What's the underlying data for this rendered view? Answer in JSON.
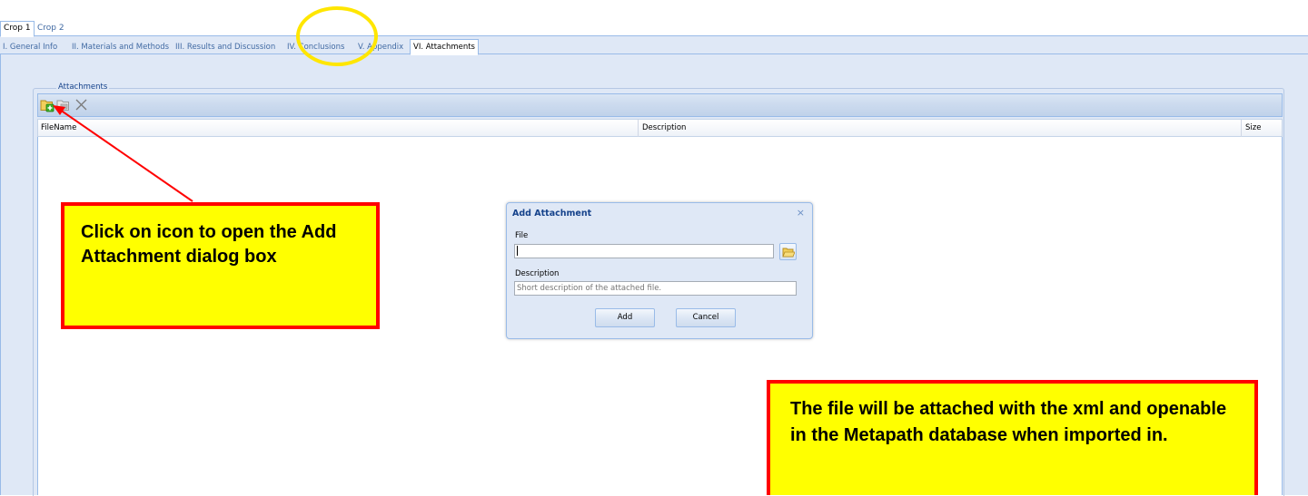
{
  "crop_tabs": [
    {
      "label": "Crop 1",
      "active": true
    },
    {
      "label": "Crop 2",
      "active": false
    }
  ],
  "section_tabs": [
    {
      "label": "I. General Info"
    },
    {
      "label": "II. Materials and Methods"
    },
    {
      "label": "III. Results and Discussion"
    },
    {
      "label": "IV. Conclusions"
    },
    {
      "label": "V. Appendix"
    },
    {
      "label": "VI. Attachments",
      "active": true
    }
  ],
  "attachments": {
    "legend": "Attachments",
    "toolbar_icons": [
      "add-attachment-icon",
      "edit-attachment-icon",
      "delete-attachment-icon"
    ],
    "columns": [
      "FileName",
      "Description",
      "Size"
    ]
  },
  "dialog": {
    "title": "Add Attachment",
    "close_glyph": "×",
    "file_label": "File",
    "file_value": "",
    "description_label": "Description",
    "description_placeholder": "Short description of the attached file.",
    "add_label": "Add",
    "cancel_label": "Cancel"
  },
  "callouts": {
    "icon_hint": "Click on icon to open the Add Attachment dialog box",
    "file_note": "The file will be attached with the xml and openable in the Metapath database when imported in."
  },
  "colors": {
    "callout_fill": "#ffff00",
    "callout_border": "#ff0000",
    "highlight_circle": "#ffe600",
    "panel_bg": "#dfe8f6"
  }
}
